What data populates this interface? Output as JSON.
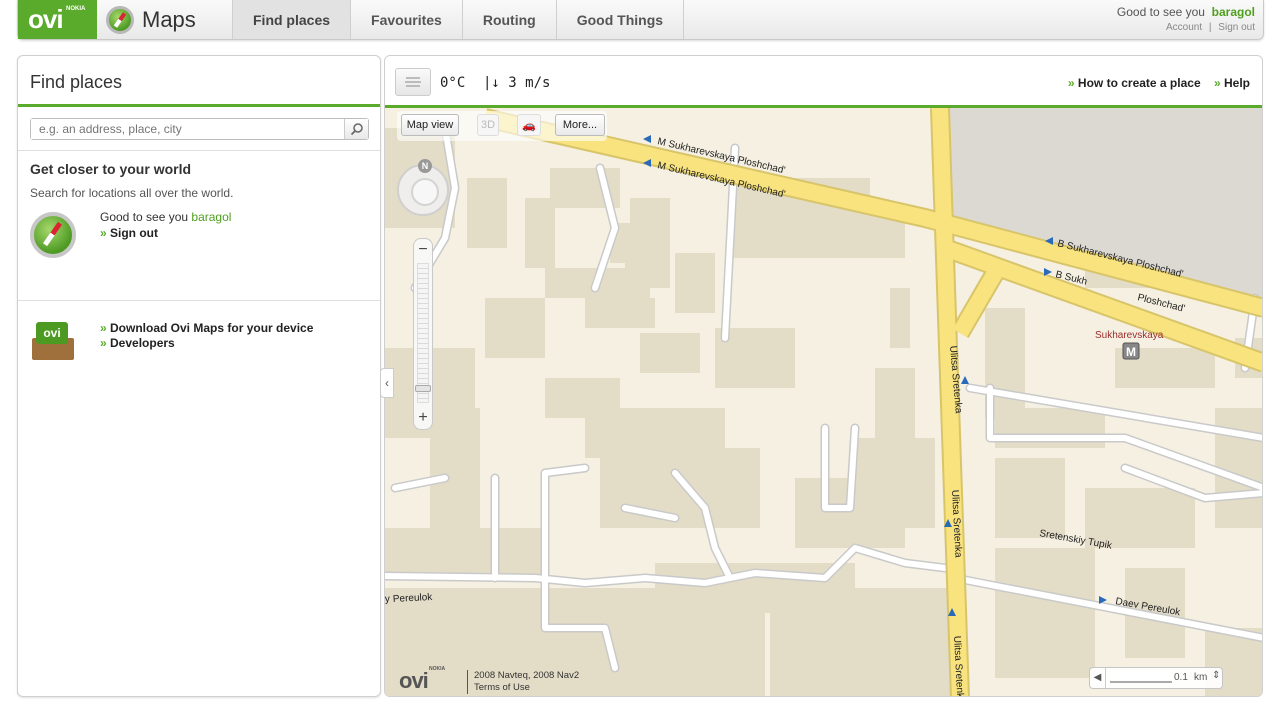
{
  "topbar": {
    "logo_text": "ovi",
    "logo_small": "NOKIA",
    "app_name": "Maps",
    "tabs": [
      {
        "label": "Find places",
        "active": true
      },
      {
        "label": "Favourites",
        "active": false
      },
      {
        "label": "Routing",
        "active": false
      },
      {
        "label": "Good Things",
        "active": false
      }
    ],
    "greeting": "Good to see you",
    "username": "baragol",
    "account_link": "Account",
    "divider": "|",
    "signout_link": "Sign out"
  },
  "left_panel": {
    "title": "Find places",
    "search_placeholder": "e.g. an address, place, city",
    "promo_title": "Get closer to your world",
    "promo_text": "Search for locations all over the world.",
    "greeting": "Good to see you",
    "username": "baragol",
    "signout_link": "Sign out",
    "box_label": "ovi",
    "download_link": "Download Ovi Maps for your device",
    "developers_link": "Developers"
  },
  "map_header": {
    "temperature": "0°C",
    "wind": "|↓ 3 m/s",
    "create_place_link": "How to create a place",
    "help_link": "Help"
  },
  "map_controls": {
    "map_view_label": "Map view",
    "three_d_label": "3D",
    "more_label": "More...",
    "north_label": "N",
    "zoom_out": "−",
    "zoom_in": "+",
    "brand": "ovi",
    "brand_small": "NOKIA",
    "copyright_line": "2008 Navteq, 2008 Nav2",
    "terms_link": "Terms of Use",
    "scale_value": "0.1",
    "scale_unit": "km"
  },
  "map_labels": {
    "street1": "M Sukharevskaya Ploshchad'",
    "street2": "M Sukharevskaya Ploshchad'",
    "street3": "B Sukharevskaya Ploshchad'",
    "street4": "B Sukh",
    "street4b": "Ploshchad'",
    "metro": "Sukharevskaya",
    "metro_icon": "M",
    "sretenka1": "Ulitsa Sretenka",
    "sretenka2": "Ulitsa Sretenka",
    "sretenka3": "Ulitsa Sretenka",
    "tupik": "Sretenskiy Tupik",
    "daev": "Daev Pereulok",
    "pereulok": "Pereulok",
    "pereulok_prefix": "y"
  },
  "colors": {
    "brand_green": "#5aab2c",
    "map_background": "#f5f0e1",
    "building": "#e3dcc7",
    "major_road": "#f8e37f",
    "minor_road": "#ffffff"
  }
}
